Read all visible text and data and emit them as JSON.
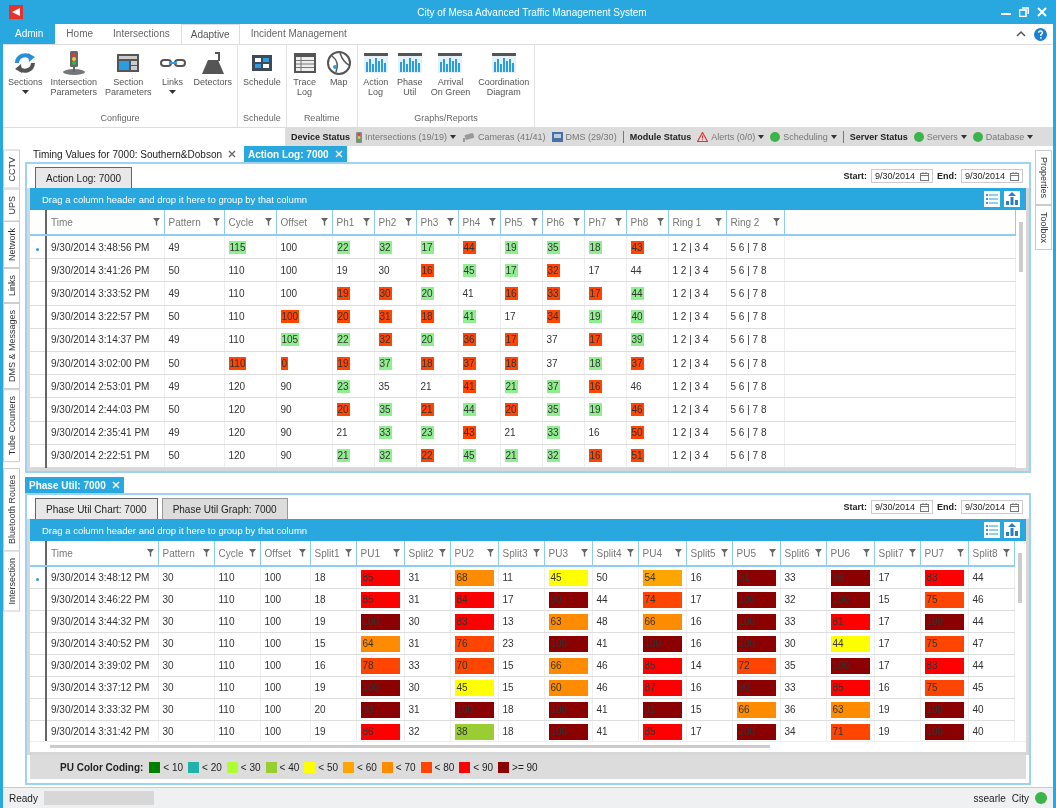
{
  "window": {
    "title": "City of Mesa Advanced Traffic Management System"
  },
  "ribbon_tabs": [
    {
      "label": "Admin",
      "kind": "app",
      "selected": false
    },
    {
      "label": "Home",
      "kind": "tab",
      "selected": false
    },
    {
      "label": "Intersections",
      "kind": "tab",
      "selected": false
    },
    {
      "label": "Adaptive",
      "kind": "tab",
      "selected": true
    },
    {
      "label": "Incident Management",
      "kind": "tab",
      "selected": false
    }
  ],
  "ribbon_groups": [
    {
      "label": "Configure",
      "buttons": [
        {
          "label": "Sections",
          "kind": "refresh",
          "dropdown": true
        },
        {
          "label": "Intersection\nParameters",
          "kind": "signal",
          "dropdown": false
        },
        {
          "label": "Section\nParameters",
          "kind": "layout",
          "dropdown": false
        },
        {
          "label": "Links",
          "kind": "link",
          "dropdown": true
        },
        {
          "label": "Detectors",
          "kind": "detector",
          "dropdown": false
        }
      ]
    },
    {
      "label": "Schedule",
      "buttons": [
        {
          "label": "Schedule",
          "kind": "grid",
          "dropdown": false
        }
      ]
    },
    {
      "label": "Realtime",
      "buttons": [
        {
          "label": "Trace\nLog",
          "kind": "table",
          "dropdown": false
        },
        {
          "label": "Map",
          "kind": "map",
          "dropdown": false
        }
      ]
    },
    {
      "label": "Graphs/Reports",
      "buttons": [
        {
          "label": "Action\nLog",
          "kind": "chart",
          "dropdown": false
        },
        {
          "label": "Phase\nUtil",
          "kind": "chart",
          "dropdown": false
        },
        {
          "label": "Arrival\nOn Green",
          "kind": "chart",
          "dropdown": false
        },
        {
          "label": "Coordination\nDiagram",
          "kind": "chart",
          "dropdown": false
        }
      ]
    }
  ],
  "status_strip": [
    {
      "title": "Device Status",
      "items": [
        {
          "label": "Intersections (19/19)",
          "kind": "signal",
          "dropdown": true
        },
        {
          "label": "Cameras (41/41)",
          "kind": "camera",
          "dropdown": false
        },
        {
          "label": "DMS (29/30)",
          "kind": "sign",
          "dropdown": false
        }
      ]
    },
    {
      "title": "Module Status",
      "items": [
        {
          "label": "Alerts (0/0)",
          "kind": "warning",
          "dropdown": true
        },
        {
          "label": "Scheduling",
          "kind": "dot",
          "color": "#3cb44b",
          "dropdown": true
        }
      ]
    },
    {
      "title": "Server Status",
      "items": [
        {
          "label": "Servers",
          "kind": "dot",
          "color": "#3cb44b",
          "dropdown": true
        },
        {
          "label": "Database",
          "kind": "dot",
          "color": "#3cb44b",
          "dropdown": true
        }
      ]
    }
  ],
  "left_tabs": [
    "CCTV",
    "UPS",
    "Network",
    "Links",
    "DMS & Messages",
    "Tube Counters",
    "Bluetooth Routes",
    "Intersection"
  ],
  "right_tabs": [
    "Properties",
    "Toolbox"
  ],
  "document_tabs": [
    {
      "label": "Timing Values for 7000: Southern&Dobson",
      "selected": false
    },
    {
      "label": "Action Log: 7000",
      "selected": true
    }
  ],
  "action_log": {
    "tabs": [
      {
        "label": "Action Log: 7000",
        "selected": true
      }
    ],
    "start_label": "Start:",
    "start": "9/30/2014",
    "end_label": "End:",
    "end": "9/30/2014",
    "group_hint": "Drag a column header and drop it here to group by that column",
    "columns": [
      "Time",
      "Pattern",
      "Cycle",
      "Offset",
      "Ph1",
      "Ph2",
      "Ph3",
      "Ph4",
      "Ph5",
      "Ph6",
      "Ph7",
      "Ph8",
      "Ring 1",
      "Ring 2"
    ],
    "rows": [
      {
        "current": true,
        "cells": [
          "9/30/2014 3:48:56 PM",
          "49",
          {
            "text": "115",
            "color": "#90ee90"
          },
          "100",
          {
            "text": "22",
            "color": "#90ee90"
          },
          {
            "text": "32",
            "color": "#90ee90"
          },
          {
            "text": "17",
            "color": "#90ee90"
          },
          {
            "text": "44",
            "color": "#ff4500"
          },
          {
            "text": "19",
            "color": "#90ee90"
          },
          {
            "text": "35",
            "color": "#90ee90"
          },
          {
            "text": "18",
            "color": "#90ee90"
          },
          {
            "text": "43",
            "color": "#ff4500"
          },
          "1 2 | 3 4",
          "5 6 | 7 8"
        ]
      },
      {
        "current": false,
        "cells": [
          "9/30/2014 3:41:26 PM",
          "50",
          "110",
          "100",
          "19",
          "30",
          {
            "text": "16",
            "color": "#ff4500"
          },
          {
            "text": "45",
            "color": "#90ee90"
          },
          {
            "text": "17",
            "color": "#90ee90"
          },
          {
            "text": "32",
            "color": "#ff4500"
          },
          "17",
          "44",
          "1 2 | 3 4",
          "5 6 | 7 8"
        ]
      },
      {
        "current": false,
        "cells": [
          "9/30/2014 3:33:52 PM",
          "49",
          "110",
          "100",
          {
            "text": "19",
            "color": "#ff4500"
          },
          {
            "text": "30",
            "color": "#ff4500"
          },
          {
            "text": "20",
            "color": "#90ee90"
          },
          "41",
          {
            "text": "16",
            "color": "#ff4500"
          },
          {
            "text": "33",
            "color": "#ff4500"
          },
          {
            "text": "17",
            "color": "#ff4500"
          },
          {
            "text": "44",
            "color": "#90ee90"
          },
          "1 2 | 3 4",
          "5 6 | 7 8"
        ]
      },
      {
        "current": false,
        "cells": [
          "9/30/2014 3:22:57 PM",
          "50",
          "110",
          {
            "text": "100",
            "color": "#ff4500"
          },
          {
            "text": "20",
            "color": "#ff4500"
          },
          {
            "text": "31",
            "color": "#ff4500"
          },
          {
            "text": "18",
            "color": "#ff4500"
          },
          {
            "text": "41",
            "color": "#90ee90"
          },
          "17",
          {
            "text": "34",
            "color": "#ff4500"
          },
          {
            "text": "19",
            "color": "#90ee90"
          },
          {
            "text": "40",
            "color": "#90ee90"
          },
          "1 2 | 3 4",
          "5 6 | 7 8"
        ]
      },
      {
        "current": false,
        "cells": [
          "9/30/2014 3:14:37 PM",
          "49",
          "110",
          {
            "text": "105",
            "color": "#90ee90"
          },
          {
            "text": "22",
            "color": "#90ee90"
          },
          {
            "text": "32",
            "color": "#ff4500"
          },
          {
            "text": "20",
            "color": "#90ee90"
          },
          {
            "text": "36",
            "color": "#ff4500"
          },
          {
            "text": "17",
            "color": "#ff4500"
          },
          "37",
          {
            "text": "17",
            "color": "#ff4500"
          },
          {
            "text": "39",
            "color": "#90ee90"
          },
          "1 2 | 3 4",
          "5 6 | 7 8"
        ]
      },
      {
        "current": false,
        "cells": [
          "9/30/2014 3:02:00 PM",
          "50",
          {
            "text": "110",
            "color": "#ff4500"
          },
          {
            "text": "0",
            "color": "#ff4500"
          },
          {
            "text": "19",
            "color": "#ff4500"
          },
          {
            "text": "37",
            "color": "#90ee90"
          },
          {
            "text": "18",
            "color": "#ff4500"
          },
          {
            "text": "37",
            "color": "#ff4500"
          },
          {
            "text": "18",
            "color": "#ff4500"
          },
          "37",
          {
            "text": "18",
            "color": "#90ee90"
          },
          {
            "text": "37",
            "color": "#ff4500"
          },
          "1 2 | 3 4",
          "5 6 | 7 8"
        ]
      },
      {
        "current": false,
        "cells": [
          "9/30/2014 2:53:01 PM",
          "49",
          "120",
          "90",
          {
            "text": "23",
            "color": "#90ee90"
          },
          "35",
          "21",
          {
            "text": "41",
            "color": "#ff4500"
          },
          {
            "text": "21",
            "color": "#90ee90"
          },
          {
            "text": "37",
            "color": "#90ee90"
          },
          {
            "text": "16",
            "color": "#ff4500"
          },
          "46",
          "1 2 | 3 4",
          "5 6 | 7 8"
        ]
      },
      {
        "current": false,
        "cells": [
          "9/30/2014 2:44:03 PM",
          "50",
          "120",
          "90",
          {
            "text": "20",
            "color": "#ff4500"
          },
          {
            "text": "35",
            "color": "#90ee90"
          },
          {
            "text": "21",
            "color": "#ff4500"
          },
          {
            "text": "44",
            "color": "#90ee90"
          },
          {
            "text": "20",
            "color": "#ff4500"
          },
          {
            "text": "35",
            "color": "#90ee90"
          },
          {
            "text": "19",
            "color": "#90ee90"
          },
          {
            "text": "46",
            "color": "#ff4500"
          },
          "1 2 | 3 4",
          "5 6 | 7 8"
        ]
      },
      {
        "current": false,
        "cells": [
          "9/30/2014 2:35:41 PM",
          "49",
          "120",
          "90",
          "21",
          {
            "text": "33",
            "color": "#90ee90"
          },
          {
            "text": "23",
            "color": "#90ee90"
          },
          {
            "text": "43",
            "color": "#ff4500"
          },
          "21",
          {
            "text": "33",
            "color": "#90ee90"
          },
          "16",
          {
            "text": "50",
            "color": "#ff4500"
          },
          "1 2 | 3 4",
          "5 6 | 7 8"
        ]
      },
      {
        "current": false,
        "cells": [
          "9/30/2014 2:22:51 PM",
          "50",
          "120",
          "90",
          {
            "text": "21",
            "color": "#90ee90"
          },
          {
            "text": "32",
            "color": "#90ee90"
          },
          {
            "text": "22",
            "color": "#ff4500"
          },
          {
            "text": "45",
            "color": "#90ee90"
          },
          {
            "text": "21",
            "color": "#90ee90"
          },
          {
            "text": "32",
            "color": "#90ee90"
          },
          {
            "text": "16",
            "color": "#ff4500"
          },
          {
            "text": "51",
            "color": "#ff4500"
          },
          "1 2 | 3 4",
          "5 6 | 7 8"
        ]
      }
    ]
  },
  "phase_util": {
    "header_tab": "Phase Util: 7000",
    "tabs": [
      {
        "label": "Phase Util Chart: 7000",
        "selected": true
      },
      {
        "label": "Phase Util Graph: 7000",
        "selected": false
      }
    ],
    "start_label": "Start:",
    "start": "9/30/2014",
    "end_label": "End:",
    "end": "9/30/2014",
    "group_hint": "Drag a column header and drop it here to group by that column",
    "columns": [
      "Time",
      "Pattern",
      "Cycle",
      "Offset",
      "Split1",
      "PU1",
      "Split2",
      "PU2",
      "Split3",
      "PU3",
      "Split4",
      "PU4",
      "Split5",
      "PU5",
      "Split6",
      "PU6",
      "Split7",
      "PU7",
      "Split8"
    ],
    "rows": [
      {
        "current": true,
        "cells": [
          "9/30/2014 3:48:12 PM",
          "30",
          "110",
          "100",
          "18",
          {
            "text": "85",
            "color": "#ff0000"
          },
          "31",
          {
            "text": "68",
            "color": "#ff8c00"
          },
          "11",
          {
            "text": "45",
            "color": "#ffff00"
          },
          "50",
          {
            "text": "54",
            "color": "#ffa500"
          },
          "16",
          {
            "text": "91",
            "color": "#8b0000"
          },
          "33",
          {
            "text": "96",
            "color": "#8b0000"
          },
          "17",
          {
            "text": "83",
            "color": "#ff0000"
          },
          "44"
        ]
      },
      {
        "current": false,
        "cells": [
          "9/30/2014 3:46:22 PM",
          "30",
          "110",
          "100",
          "18",
          {
            "text": "85",
            "color": "#ff0000"
          },
          "31",
          {
            "text": "84",
            "color": "#ff0000"
          },
          "17",
          {
            "text": "90",
            "color": "#8b0000"
          },
          "44",
          {
            "text": "74",
            "color": "#ff4500"
          },
          "17",
          {
            "text": "100",
            "color": "#8b0000"
          },
          "32",
          {
            "text": "100",
            "color": "#8b0000"
          },
          "15",
          {
            "text": "75",
            "color": "#ff4500"
          },
          "46"
        ]
      },
      {
        "current": false,
        "cells": [
          "9/30/2014 3:44:32 PM",
          "30",
          "110",
          "100",
          "19",
          {
            "text": "100",
            "color": "#8b0000"
          },
          "30",
          {
            "text": "83",
            "color": "#ff0000"
          },
          "13",
          {
            "text": "63",
            "color": "#ff8c00"
          },
          "48",
          {
            "text": "66",
            "color": "#ff8c00"
          },
          "16",
          {
            "text": "100",
            "color": "#8b0000"
          },
          "33",
          {
            "text": "81",
            "color": "#ff0000"
          },
          "17",
          {
            "text": "100",
            "color": "#8b0000"
          },
          "44"
        ]
      },
      {
        "current": false,
        "cells": [
          "9/30/2014 3:40:52 PM",
          "30",
          "110",
          "100",
          "15",
          {
            "text": "64",
            "color": "#ff8c00"
          },
          "31",
          {
            "text": "76",
            "color": "#ff4500"
          },
          "23",
          {
            "text": "100",
            "color": "#8b0000"
          },
          "41",
          {
            "text": "100",
            "color": "#8b0000"
          },
          "16",
          {
            "text": "100",
            "color": "#8b0000"
          },
          "30",
          {
            "text": "44",
            "color": "#ffff00"
          },
          "17",
          {
            "text": "75",
            "color": "#ff4500"
          },
          "47"
        ]
      },
      {
        "current": false,
        "cells": [
          "9/30/2014 3:39:02 PM",
          "30",
          "110",
          "100",
          "16",
          {
            "text": "78",
            "color": "#ff4500"
          },
          "33",
          {
            "text": "70",
            "color": "#ff4500"
          },
          "15",
          {
            "text": "66",
            "color": "#ff8c00"
          },
          "46",
          {
            "text": "85",
            "color": "#ff0000"
          },
          "14",
          {
            "text": "72",
            "color": "#ff4500"
          },
          "35",
          {
            "text": "100",
            "color": "#8b0000"
          },
          "17",
          {
            "text": "83",
            "color": "#ff0000"
          },
          "44"
        ]
      },
      {
        "current": false,
        "cells": [
          "9/30/2014 3:37:12 PM",
          "30",
          "110",
          "100",
          "19",
          {
            "text": "100",
            "color": "#8b0000"
          },
          "30",
          {
            "text": "45",
            "color": "#ffff00"
          },
          "15",
          {
            "text": "60",
            "color": "#ff8c00"
          },
          "46",
          {
            "text": "87",
            "color": "#ff0000"
          },
          "16",
          {
            "text": "90",
            "color": "#8b0000"
          },
          "33",
          {
            "text": "85",
            "color": "#ff0000"
          },
          "16",
          {
            "text": "75",
            "color": "#ff4500"
          },
          "45"
        ]
      },
      {
        "current": false,
        "cells": [
          "9/30/2014 3:33:32 PM",
          "30",
          "110",
          "100",
          "20",
          {
            "text": "93",
            "color": "#8b0000"
          },
          "31",
          {
            "text": "100",
            "color": "#8b0000"
          },
          "18",
          {
            "text": "100",
            "color": "#8b0000"
          },
          "41",
          {
            "text": "91",
            "color": "#8b0000"
          },
          "15",
          {
            "text": "66",
            "color": "#ff8c00"
          },
          "36",
          {
            "text": "63",
            "color": "#ff8c00"
          },
          "19",
          {
            "text": "100",
            "color": "#8b0000"
          },
          "40"
        ]
      },
      {
        "current": false,
        "cells": [
          "9/30/2014 3:31:42 PM",
          "30",
          "110",
          "100",
          "19",
          {
            "text": "86",
            "color": "#ff0000"
          },
          "32",
          {
            "text": "38",
            "color": "#9acd32"
          },
          "18",
          {
            "text": "100",
            "color": "#8b0000"
          },
          "41",
          {
            "text": "85",
            "color": "#ff0000"
          },
          "17",
          {
            "text": "100",
            "color": "#8b0000"
          },
          "34",
          {
            "text": "71",
            "color": "#ff4500"
          },
          "19",
          {
            "text": "100",
            "color": "#8b0000"
          },
          "40"
        ]
      }
    ],
    "legend": {
      "label": "PU Color Coding:",
      "items": [
        {
          "color": "#008000",
          "label": "< 10"
        },
        {
          "color": "#20b2aa",
          "label": "< 20"
        },
        {
          "color": "#adff2f",
          "label": "< 30"
        },
        {
          "color": "#9acd32",
          "label": "< 40"
        },
        {
          "color": "#ffff00",
          "label": "< 50"
        },
        {
          "color": "#ffa500",
          "label": "< 60"
        },
        {
          "color": "#ff8c00",
          "label": "< 70"
        },
        {
          "color": "#ff4500",
          "label": "< 80"
        },
        {
          "color": "#ff0000",
          "label": "< 90"
        },
        {
          "color": "#8b0000",
          "label": ">= 90"
        }
      ]
    }
  },
  "status_bar": {
    "text": "Ready",
    "user": "ssearle",
    "role": "City",
    "connected": true
  }
}
